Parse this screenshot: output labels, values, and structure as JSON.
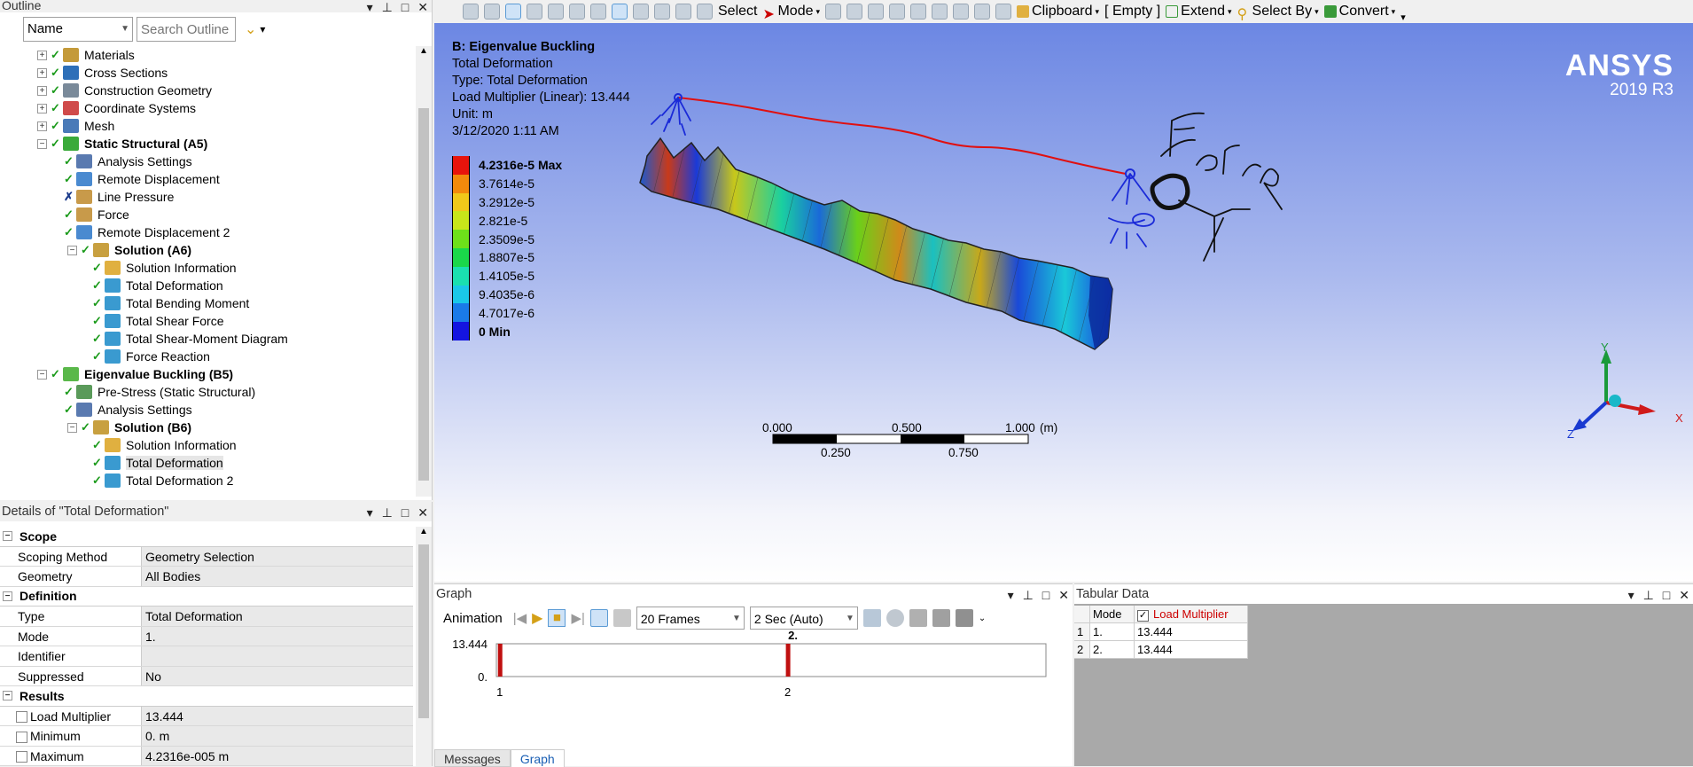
{
  "outline": {
    "title": "Outline",
    "controls": [
      "▾",
      "⊸",
      "□",
      "✕"
    ],
    "name_combo": "Name",
    "search_placeholder": "Search Outline",
    "tree": [
      {
        "label": "Materials",
        "bold": false,
        "indent": 1,
        "expander": "+",
        "check": "✓",
        "icon": "#c49a3a"
      },
      {
        "label": "Cross Sections",
        "bold": false,
        "indent": 1,
        "expander": "+",
        "check": "✓",
        "icon": "#2e6fb8"
      },
      {
        "label": "Construction Geometry",
        "bold": false,
        "indent": 1,
        "expander": "+",
        "check": "✓",
        "icon": "#7a8a9a"
      },
      {
        "label": "Coordinate Systems",
        "bold": false,
        "indent": 1,
        "expander": "+",
        "check": "✓",
        "icon": "#d04a4a"
      },
      {
        "label": "Mesh",
        "bold": false,
        "indent": 1,
        "expander": "+",
        "check": "✓",
        "icon": "#4a7ab8"
      },
      {
        "label": "Static Structural (A5)",
        "bold": true,
        "indent": 1,
        "expander": "−",
        "check": "✓",
        "icon": "#3aaa3a"
      },
      {
        "label": "Analysis Settings",
        "bold": false,
        "indent": 2,
        "expander": "",
        "check": "✓",
        "icon": "#5a7ab0"
      },
      {
        "label": "Remote Displacement",
        "bold": false,
        "indent": 2,
        "expander": "",
        "check": "✓",
        "icon": "#4a8ad0"
      },
      {
        "label": "Line Pressure",
        "bold": false,
        "indent": 2,
        "expander": "",
        "check": "✗",
        "icon": "#c89a4a"
      },
      {
        "label": "Force",
        "bold": false,
        "indent": 2,
        "expander": "",
        "check": "✓",
        "icon": "#c89a4a"
      },
      {
        "label": "Remote Displacement 2",
        "bold": false,
        "indent": 2,
        "expander": "",
        "check": "✓",
        "icon": "#4a8ad0"
      },
      {
        "label": "Solution (A6)",
        "bold": true,
        "indent": 2,
        "expander": "−",
        "check": "✓",
        "icon": "#c8a040"
      },
      {
        "label": "Solution Information",
        "bold": false,
        "indent": 3,
        "expander": "",
        "check": "✓",
        "icon": "#e0b040"
      },
      {
        "label": "Total Deformation",
        "bold": false,
        "indent": 3,
        "expander": "",
        "check": "✓",
        "icon": "#3a9ad0"
      },
      {
        "label": "Total Bending Moment",
        "bold": false,
        "indent": 3,
        "expander": "",
        "check": "✓",
        "icon": "#3a9ad0"
      },
      {
        "label": "Total Shear Force",
        "bold": false,
        "indent": 3,
        "expander": "",
        "check": "✓",
        "icon": "#3a9ad0"
      },
      {
        "label": "Total Shear-Moment Diagram",
        "bold": false,
        "indent": 3,
        "expander": "",
        "check": "✓",
        "icon": "#3a9ad0"
      },
      {
        "label": "Force Reaction",
        "bold": false,
        "indent": 3,
        "expander": "",
        "check": "✓",
        "icon": "#3a9ad0"
      },
      {
        "label": "Eigenvalue Buckling (B5)",
        "bold": true,
        "indent": 1,
        "expander": "−",
        "check": "✓",
        "icon": "#5ab84a"
      },
      {
        "label": "Pre-Stress (Static Structural)",
        "bold": false,
        "indent": 2,
        "expander": "",
        "check": "✓",
        "icon": "#5a9a5a"
      },
      {
        "label": "Analysis Settings",
        "bold": false,
        "indent": 2,
        "expander": "",
        "check": "✓",
        "icon": "#5a7ab0"
      },
      {
        "label": "Solution (B6)",
        "bold": true,
        "indent": 2,
        "expander": "−",
        "check": "✓",
        "icon": "#c8a040"
      },
      {
        "label": "Solution Information",
        "bold": false,
        "indent": 3,
        "expander": "",
        "check": "✓",
        "icon": "#e0b040"
      },
      {
        "label": "Total Deformation",
        "bold": false,
        "indent": 3,
        "expander": "",
        "check": "✓",
        "icon": "#3a9ad0",
        "selected": true
      },
      {
        "label": "Total Deformation 2",
        "bold": false,
        "indent": 3,
        "expander": "",
        "check": "✓",
        "icon": "#3a9ad0"
      }
    ]
  },
  "details": {
    "title": "Details of \"Total Deformation\"",
    "sections": [
      {
        "name": "Scope",
        "rows": [
          {
            "key": "Scoping Method",
            "value": "Geometry Selection",
            "checkbox": false
          },
          {
            "key": "Geometry",
            "value": "All Bodies",
            "checkbox": false
          }
        ]
      },
      {
        "name": "Definition",
        "rows": [
          {
            "key": "Type",
            "value": "Total Deformation",
            "checkbox": false
          },
          {
            "key": "Mode",
            "value": "1.",
            "checkbox": false
          },
          {
            "key": "Identifier",
            "value": "",
            "checkbox": false
          },
          {
            "key": "Suppressed",
            "value": "No",
            "checkbox": false
          }
        ]
      },
      {
        "name": "Results",
        "rows": [
          {
            "key": "Load Multiplier",
            "value": "13.444",
            "checkbox": true
          },
          {
            "key": "Minimum",
            "value": "0. m",
            "checkbox": true
          },
          {
            "key": "Maximum",
            "value": "4.2316e-005 m",
            "checkbox": true
          }
        ]
      }
    ]
  },
  "toolbar": {
    "select": "Select",
    "mode": "Mode",
    "clipboard": "Clipboard",
    "empty": "[ Empty ]",
    "extend": "Extend",
    "select_by": "Select By",
    "convert": "Convert"
  },
  "viewport": {
    "result_title": "B: Eigenvalue Buckling",
    "info_lines": [
      "Total Deformation",
      "Type: Total Deformation",
      "Load Multiplier (Linear): 13.444",
      "Unit: m",
      "3/12/2020 1:11 AM"
    ],
    "legend": [
      {
        "label": "4.2316e-5 Max",
        "color": "#e8140c",
        "bold": true
      },
      {
        "label": "3.7614e-5",
        "color": "#f28a0c",
        "bold": false
      },
      {
        "label": "3.2912e-5",
        "color": "#f0c81a",
        "bold": false
      },
      {
        "label": "2.821e-5",
        "color": "#c8e61a",
        "bold": false
      },
      {
        "label": "2.3509e-5",
        "color": "#6ee01a",
        "bold": false
      },
      {
        "label": "1.8807e-5",
        "color": "#1ad84a",
        "bold": false
      },
      {
        "label": "1.4105e-5",
        "color": "#1ae0b0",
        "bold": false
      },
      {
        "label": "9.4035e-6",
        "color": "#1ac8e8",
        "bold": false
      },
      {
        "label": "4.7017e-6",
        "color": "#1a7ae8",
        "bold": false
      },
      {
        "label": "0 Min",
        "color": "#1414e0",
        "bold": true
      }
    ],
    "brand_name": "ANSYS",
    "brand_version": "2019 R3",
    "scale_top": [
      "0.000",
      "0.500",
      "1.000"
    ],
    "scale_unit": "(m)",
    "scale_bottom": [
      "0.250",
      "0.750"
    ],
    "axis_x": "X",
    "axis_y": "Y",
    "axis_z": "Z",
    "drawn_text": "Force"
  },
  "graph": {
    "title": "Graph",
    "animation_label": "Animation",
    "frames": "20 Frames",
    "duration": "2 Sec (Auto)",
    "tabs": [
      "Messages",
      "Graph"
    ],
    "chart_data": {
      "type": "bar",
      "categories": [
        "1",
        "2"
      ],
      "values": [
        13.444,
        13.444
      ],
      "ylim": [
        0,
        13.444
      ],
      "ytick_labels": [
        "0.",
        "13.444"
      ],
      "highlight_label": "2."
    }
  },
  "tabular": {
    "title": "Tabular Data",
    "headers": [
      "Mode",
      "Load Multiplier"
    ],
    "rows": [
      {
        "idx": "1",
        "mode": "1.",
        "value": "13.444"
      },
      {
        "idx": "2",
        "mode": "2.",
        "value": "13.444"
      }
    ]
  }
}
